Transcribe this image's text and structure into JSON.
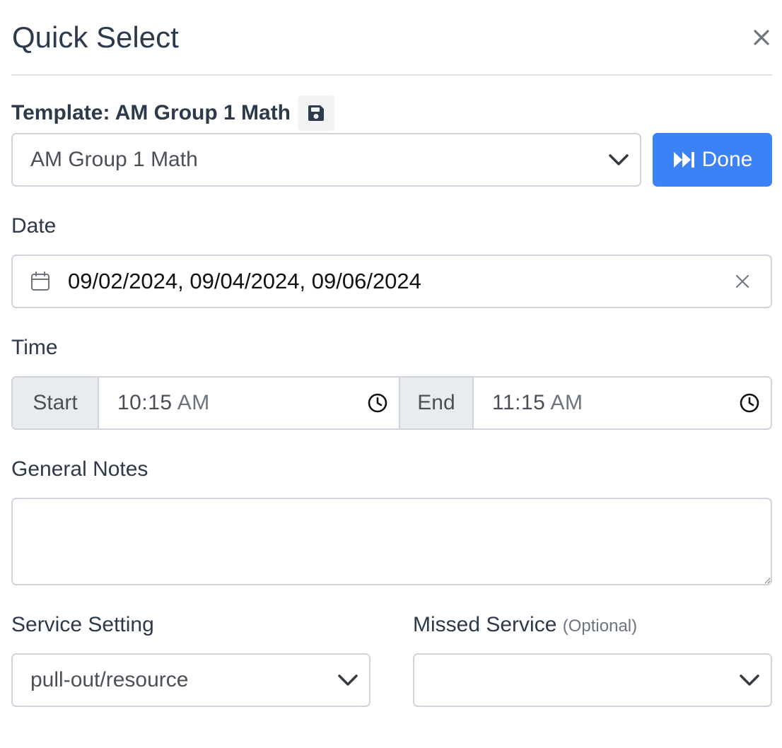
{
  "header": {
    "title": "Quick Select"
  },
  "template": {
    "label": "Template: AM Group 1 Math",
    "selected": "AM Group 1 Math",
    "done_label": "Done"
  },
  "date": {
    "label": "Date",
    "value": "09/02/2024, 09/04/2024, 09/06/2024"
  },
  "time": {
    "label": "Time",
    "start_label": "Start",
    "start_time": "10:15",
    "start_ampm": "AM",
    "end_label": "End",
    "end_time": "11:15",
    "end_ampm": "AM"
  },
  "notes": {
    "label": "General Notes",
    "value": ""
  },
  "service_setting": {
    "label": "Service Setting",
    "selected": "pull-out/resource"
  },
  "missed_service": {
    "label": "Missed Service",
    "optional_label": "(Optional)",
    "selected": ""
  },
  "colors": {
    "primary": "#3b82f6",
    "title": "#2c3a4b",
    "border": "#ced4da",
    "addon_bg": "#e9ecef"
  },
  "icons": [
    "close-icon",
    "save-icon",
    "chevron-down-icon",
    "fast-forward-icon",
    "calendar-icon",
    "clear-icon",
    "clock-icon"
  ]
}
